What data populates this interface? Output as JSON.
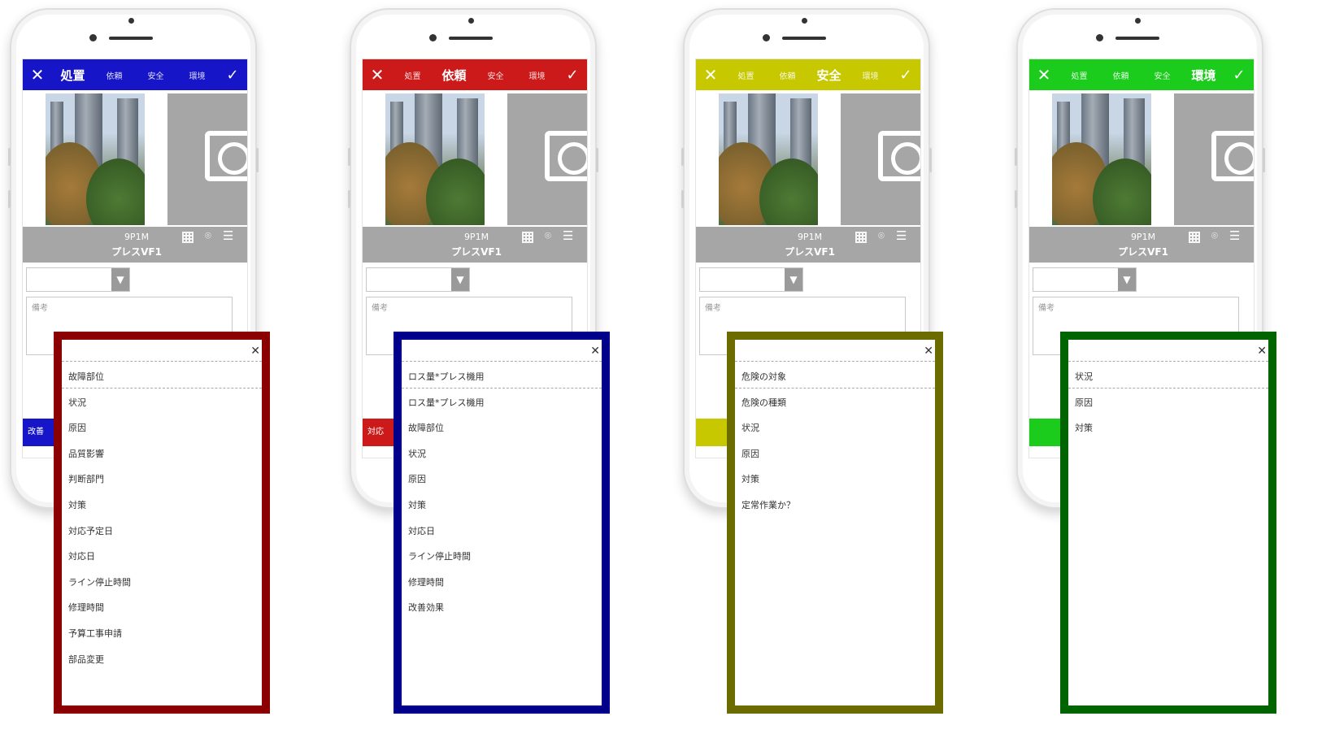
{
  "phones": [
    {
      "color": "#1616c8",
      "overlay_color": "#8b0000",
      "tabs": [
        "処置",
        "依頼",
        "安全",
        "環境"
      ],
      "active_tab": 0,
      "machine_code": "9P1M",
      "machine_name": "プレスVF1",
      "notes_placeholder": "備考",
      "footer_label": "改善",
      "options": [
        "故障部位",
        "状況",
        "原因",
        "品質影響",
        "判断部門",
        "対策",
        "対応予定日",
        "対応日",
        "ライン停止時間",
        "修理時間",
        "予算工事申請",
        "部品変更"
      ]
    },
    {
      "color": "#cc1a1a",
      "overlay_color": "#00008b",
      "tabs": [
        "処置",
        "依頼",
        "安全",
        "環境"
      ],
      "active_tab": 1,
      "machine_code": "9P1M",
      "machine_name": "プレスVF1",
      "notes_placeholder": "備考",
      "footer_label": "対応",
      "options": [
        "ロス量*プレス機用",
        "ロス量*プレス機用",
        "故障部位",
        "状況",
        "原因",
        "対策",
        "対応日",
        "ライン停止時間",
        "修理時間",
        "改善効果"
      ]
    },
    {
      "color": "#c8c800",
      "overlay_color": "#6b6b00",
      "tabs": [
        "処置",
        "依頼",
        "安全",
        "環境"
      ],
      "active_tab": 2,
      "machine_code": "9P1M",
      "machine_name": "プレスVF1",
      "notes_placeholder": "備考",
      "footer_label": "",
      "options": [
        "危険の対象",
        "危険の種類",
        "状況",
        "原因",
        "対策",
        "定常作業か？"
      ]
    },
    {
      "color": "#1ccc1c",
      "overlay_color": "#006400",
      "tabs": [
        "処置",
        "依頼",
        "安全",
        "環境"
      ],
      "active_tab": 3,
      "machine_code": "9P1M",
      "machine_name": "プレスVF1",
      "notes_placeholder": "備考",
      "footer_label": "",
      "options": [
        "状況",
        "原因",
        "対策"
      ]
    }
  ],
  "icons": {
    "close": "close-icon",
    "confirm": "checkmark-icon",
    "camera": "camera-icon",
    "qr": "qr-code-icon",
    "location": "location-pin-icon",
    "list": "list-icon",
    "dropdown": "chevron-down-icon"
  }
}
